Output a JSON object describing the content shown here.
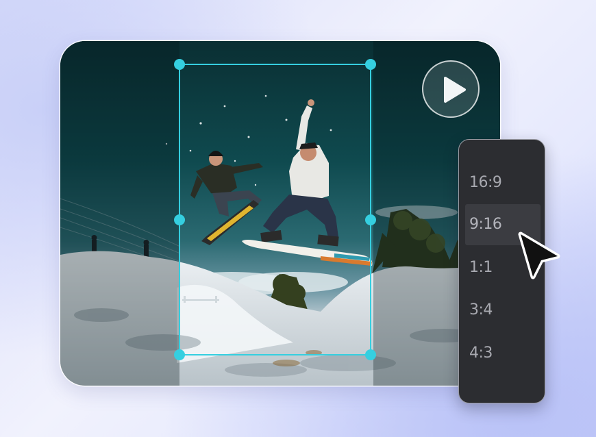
{
  "editor": {
    "play_icon": "play-icon",
    "crop_accent_color": "#35cfe0"
  },
  "ratio_menu": {
    "selected": "9:16",
    "items": [
      {
        "label": "16:9"
      },
      {
        "label": "9:16"
      },
      {
        "label": "1:1"
      },
      {
        "label": "3:4"
      },
      {
        "label": "4:3"
      }
    ]
  },
  "cursor_icon": "pointer-cursor-icon"
}
